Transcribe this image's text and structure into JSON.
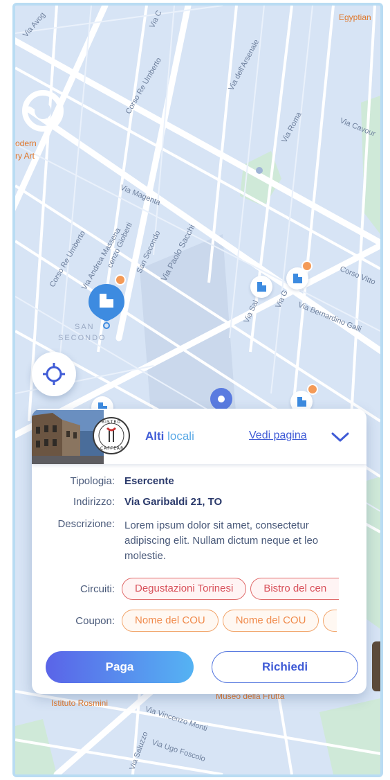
{
  "map": {
    "labels": [
      "Via Avog",
      "Via C",
      "Corso Re Umberto",
      "Via dell'Arsenale",
      "Egyptian",
      "Via Roma",
      "Via Cavour",
      "odern",
      "ry Art",
      "Via Magenta",
      "Corso Re Umberto",
      "Via Andrea Massena",
      "cenzo Gioberti",
      "San Secondo",
      "Via Paolo Sacchi",
      "Corso Vitto",
      "Via Sal",
      "Via G",
      "Via Bernardino Galli",
      "SAN",
      "SECONDO",
      "Istituto Rosmini",
      "Via Vincenzo Monti",
      "Via Ugo Foscolo",
      "Via Saluzzo",
      "Museo della Frutta"
    ]
  },
  "card": {
    "title_part1": "Alti ",
    "title_part2": "locali",
    "vedi_link": "Vedi pagina",
    "logo_text_top": "BISTRO",
    "logo_text_bottom": "CAFFEAR",
    "tipologia_label": "Tipologia:",
    "tipologia_value": "Esercente",
    "indirizzo_label": "Indirizzo:",
    "indirizzo_value": "Via Garibaldi 21,  TO",
    "descrizione_label": "Descrizione:",
    "descrizione_value": "Lorem ipsum dolor sit amet, consectetur adipiscing elit. Nullam dictum neque et leo molestie.",
    "circuiti_label": "Circuiti:",
    "circuiti": [
      "Degustazioni Torinesi",
      "Bistro del cen"
    ],
    "coupon_label": "Coupon:",
    "coupons": [
      "Nome del COU",
      "Nome del COU",
      ""
    ],
    "paga_label": "Paga",
    "richiedi_label": "Richiedi"
  },
  "colors": {
    "primary": "#3f5bd6",
    "accent_blue": "#5aa9e6",
    "circuit_red": "#d8505a",
    "coupon_orange": "#f08a4b",
    "map_bg": "#d7e4f5"
  }
}
